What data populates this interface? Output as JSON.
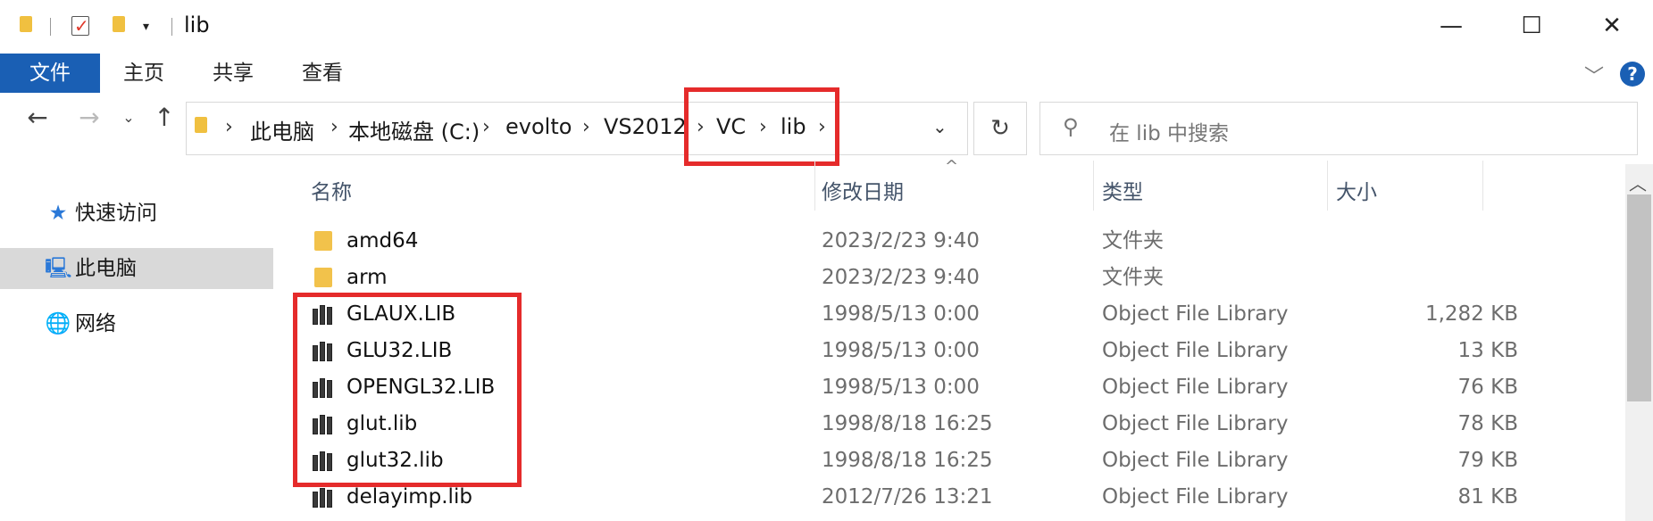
{
  "window": {
    "title": "lib",
    "controls": {
      "minimize": "—",
      "maximize": "☐",
      "close": "✕"
    }
  },
  "ribbon": {
    "tabs": [
      "文件",
      "主页",
      "共享",
      "查看"
    ],
    "help": "?"
  },
  "address": {
    "crumbs": [
      "此电脑",
      "本地磁盘 (C:)",
      "evolto",
      "VS2012",
      "VC",
      "lib"
    ],
    "highlighted_crumbs": [
      "VC",
      "lib"
    ]
  },
  "search": {
    "placeholder": "在 lib 中搜索"
  },
  "sidebar": {
    "items": [
      {
        "label": "快速访问",
        "icon": "star-icon"
      },
      {
        "label": "此电脑",
        "icon": "computer-icon",
        "selected": true
      },
      {
        "label": "网络",
        "icon": "network-icon"
      }
    ]
  },
  "columns": {
    "name": "名称",
    "date": "修改日期",
    "type": "类型",
    "size": "大小"
  },
  "files": [
    {
      "name": "amd64",
      "date": "2023/2/23 9:40",
      "type": "文件夹",
      "size": "",
      "icon": "folder-icon"
    },
    {
      "name": "arm",
      "date": "2023/2/23 9:40",
      "type": "文件夹",
      "size": "",
      "icon": "folder-icon"
    },
    {
      "name": "GLAUX.LIB",
      "date": "1998/5/13 0:00",
      "type": "Object File Library",
      "size": "1,282 KB",
      "icon": "library-icon",
      "highlighted": true
    },
    {
      "name": "GLU32.LIB",
      "date": "1998/5/13 0:00",
      "type": "Object File Library",
      "size": "13 KB",
      "icon": "library-icon",
      "highlighted": true
    },
    {
      "name": "OPENGL32.LIB",
      "date": "1998/5/13 0:00",
      "type": "Object File Library",
      "size": "76 KB",
      "icon": "library-icon",
      "highlighted": true
    },
    {
      "name": "glut.lib",
      "date": "1998/8/18 16:25",
      "type": "Object File Library",
      "size": "78 KB",
      "icon": "library-icon",
      "highlighted": true
    },
    {
      "name": "glut32.lib",
      "date": "1998/8/18 16:25",
      "type": "Object File Library",
      "size": "79 KB",
      "icon": "library-icon",
      "highlighted": true
    },
    {
      "name": "delayimp.lib",
      "date": "2012/7/26 13:21",
      "type": "Object File Library",
      "size": "81 KB",
      "icon": "library-icon"
    }
  ],
  "colors": {
    "accent": "#1a5fb4",
    "highlight_box": "#e52b2b",
    "folder": "#f2c24b",
    "selection": "#d9d9d9"
  }
}
